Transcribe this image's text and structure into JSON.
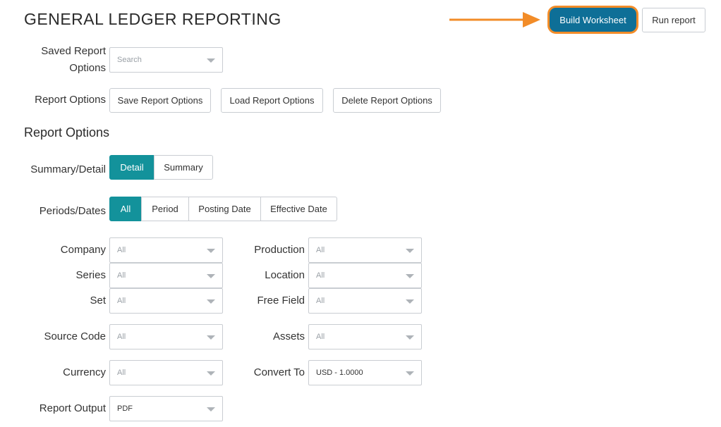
{
  "header": {
    "title": "GENERAL LEDGER REPORTING",
    "dot": "."
  },
  "toolbar": {
    "build_worksheet": "Build Worksheet",
    "run_report": "Run report",
    "highlight_color": "#f28c28",
    "primary_color": "#0e6f97"
  },
  "saved_report": {
    "label_line1": "Saved Report",
    "label_line2": "Options",
    "placeholder": "Search"
  },
  "report_options_buttons": {
    "label": "Report Options",
    "save": "Save Report Options",
    "load": "Load Report Options",
    "delete": "Delete Report Options"
  },
  "section": {
    "title": "Report Options"
  },
  "summary_detail": {
    "label": "Summary/Detail",
    "options": [
      "Detail",
      "Summary"
    ],
    "selected": "Detail",
    "active_color": "#13929b"
  },
  "periods_dates": {
    "label": "Periods/Dates",
    "options": [
      "All",
      "Period",
      "Posting Date",
      "Effective Date"
    ],
    "selected": "All"
  },
  "filters": {
    "company": {
      "label": "Company",
      "value": "All"
    },
    "production": {
      "label": "Production",
      "value": "All"
    },
    "series": {
      "label": "Series",
      "value": "All"
    },
    "location": {
      "label": "Location",
      "value": "All"
    },
    "set": {
      "label": "Set",
      "value": "All"
    },
    "free_field": {
      "label": "Free Field",
      "value": "All"
    },
    "source_code": {
      "label": "Source Code",
      "value": "All"
    },
    "assets": {
      "label": "Assets",
      "value": "All"
    },
    "currency": {
      "label": "Currency",
      "value": "All"
    },
    "convert_to": {
      "label": "Convert To",
      "value": "USD - 1.0000"
    },
    "report_output": {
      "label": "Report Output",
      "value": "PDF"
    }
  }
}
